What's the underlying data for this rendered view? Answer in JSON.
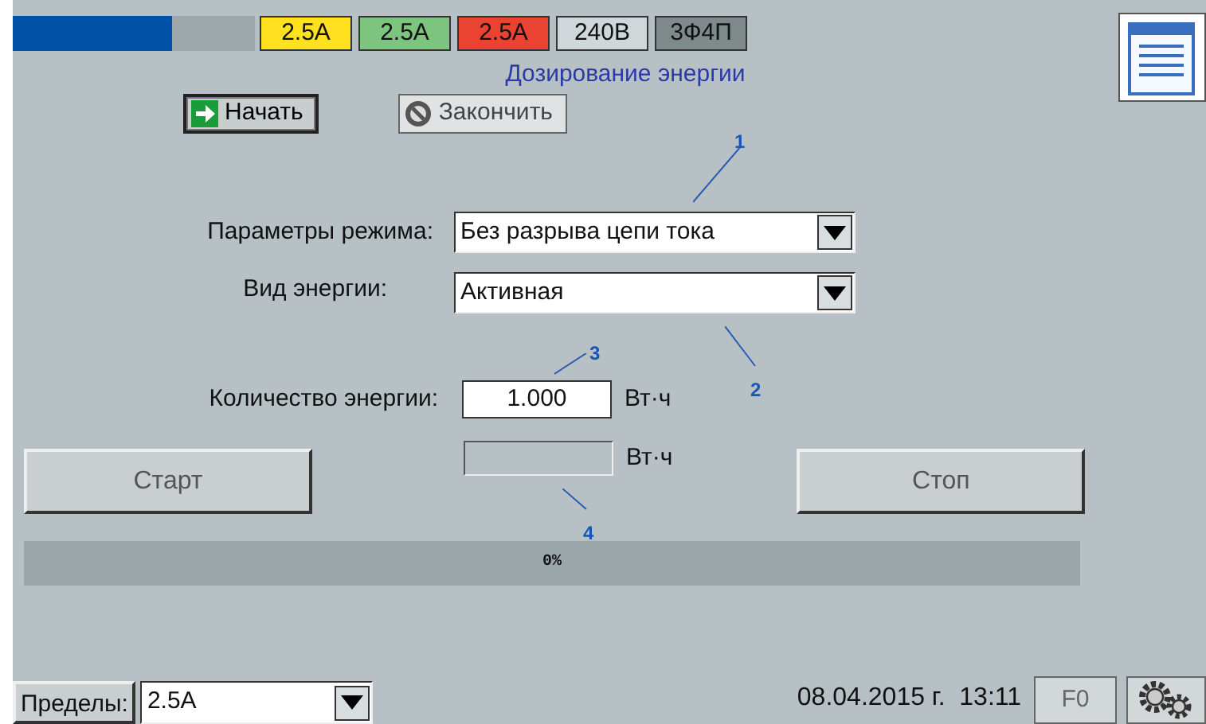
{
  "indicators": [
    {
      "text": "2.5A",
      "color": "#ffe11f"
    },
    {
      "text": "2.5A",
      "color": "#7dc47f"
    },
    {
      "text": "2.5A",
      "color": "#ea4331"
    },
    {
      "text": "240B",
      "color": "#d0d7da"
    },
    {
      "text": "3Ф4П",
      "color": "#7e8a8c"
    }
  ],
  "title": "Дозирование энергии",
  "actions": [
    {
      "label": "Начать",
      "kind": "go",
      "disabled": false
    },
    {
      "label": "Закончить",
      "kind": "stop",
      "disabled": true
    }
  ],
  "fields": [
    {
      "label": "Параметры режима:",
      "kind": "select",
      "value": "Без разрыва цепи тока"
    },
    {
      "label": "Вид энергии:",
      "kind": "select",
      "value": "Активная"
    },
    {
      "label": "Количество энергии:",
      "kind": "input",
      "value": "1.000",
      "unit": "Вт·ч"
    }
  ],
  "start_button": {
    "label": "Старт",
    "disabled": true
  },
  "counter": {
    "unit": "Вт·ч",
    "disabled": true
  },
  "stop_button": {
    "label": "Стоп",
    "disabled": true
  },
  "progress": {
    "level": 0,
    "text": "0%"
  },
  "callouts": [
    "1",
    "2",
    "3",
    "4"
  ],
  "footer": {
    "limits_label": "Пределы:",
    "limits_value": "2.5A",
    "datetime": "08.04.2015 г.  13:11",
    "f_button": "F0"
  }
}
